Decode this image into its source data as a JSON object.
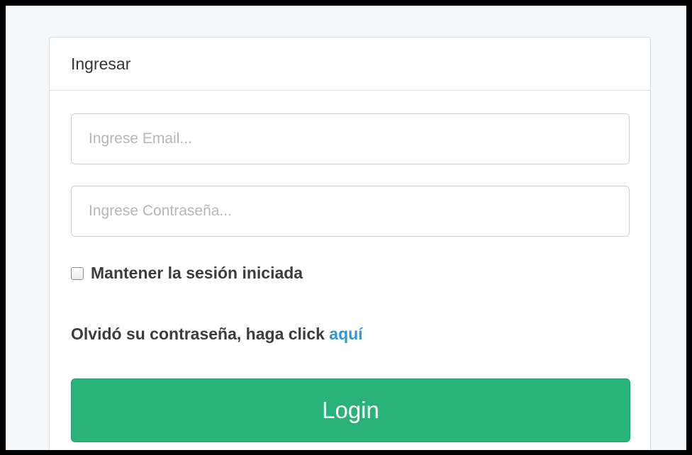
{
  "panel": {
    "heading": "Ingresar"
  },
  "form": {
    "email_placeholder": "Ingrese Email...",
    "email_value": "",
    "password_placeholder": "Ingrese Contraseña...",
    "password_value": "",
    "remember_label": "Mantener la sesión iniciada",
    "remember_checked": false,
    "forgot_text": "Olvidó su contraseña, haga click",
    "forgot_link": "aquí",
    "login_label": "Login"
  },
  "colors": {
    "accent": "#2ab27b",
    "link": "#3097d1",
    "background": "#f5f8fa"
  }
}
